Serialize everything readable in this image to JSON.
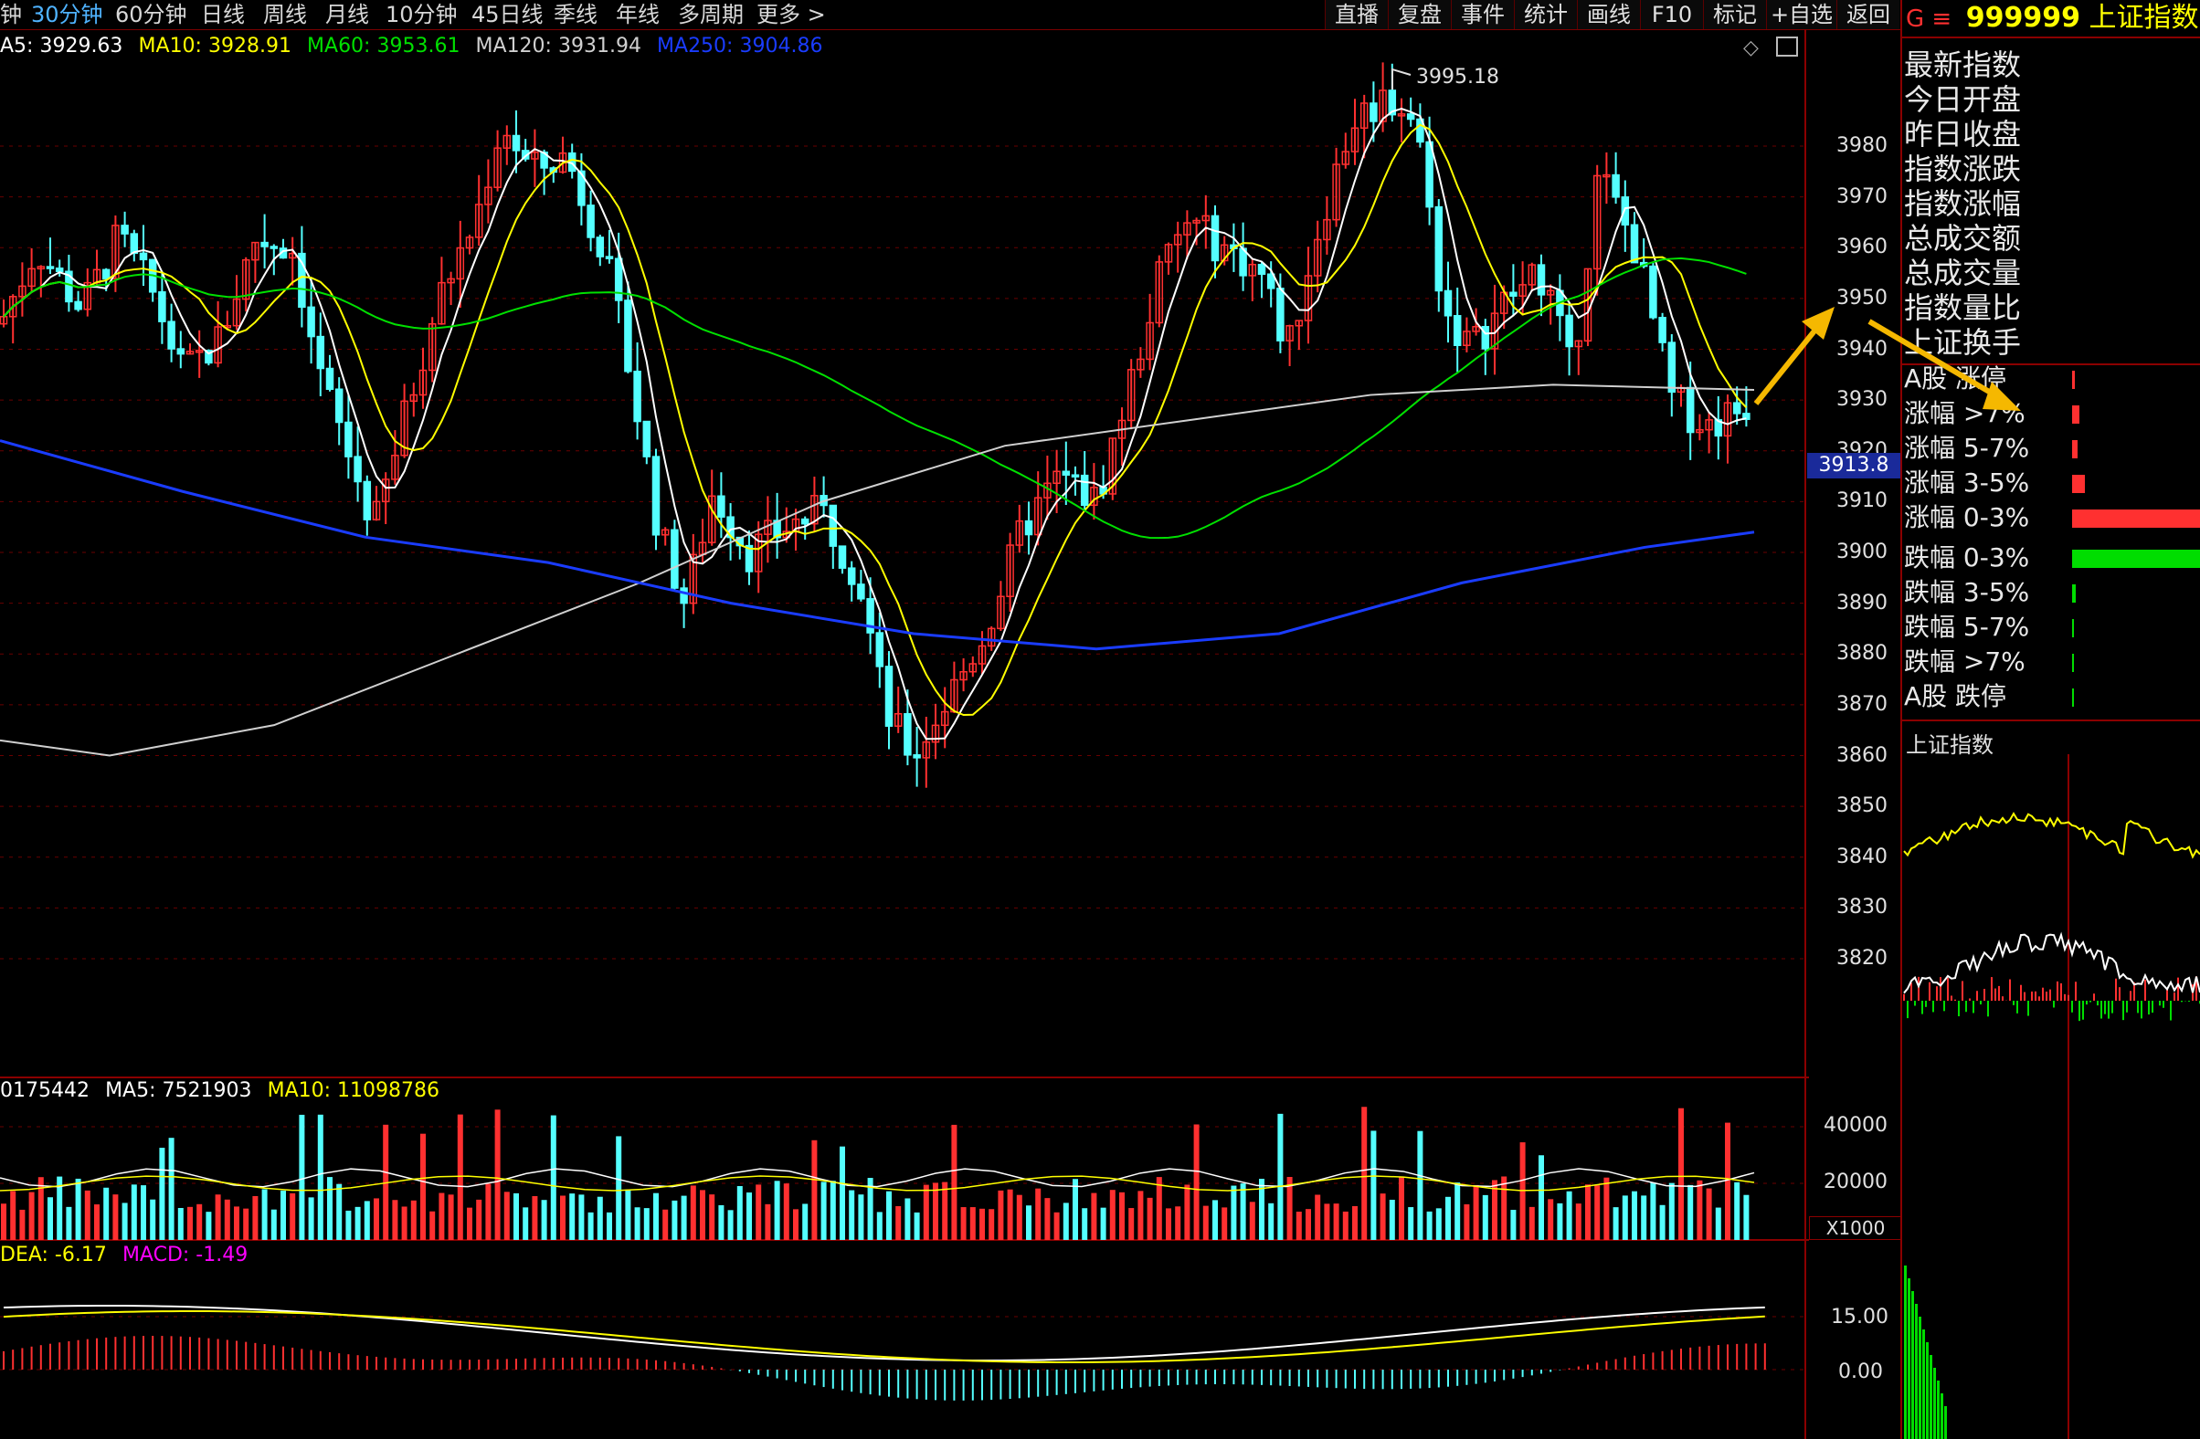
{
  "toolbar": {
    "timeframes": [
      "钟",
      "30分钟",
      "60分钟",
      "日线",
      "周线",
      "月线",
      "10分钟",
      "45日线",
      "季线",
      "年线",
      "多周期",
      "更多 >"
    ],
    "active_timeframe": "30分钟",
    "tools": [
      "直播",
      "复盘",
      "事件",
      "统计",
      "画线",
      "F10",
      "标记",
      "+自选",
      "返回"
    ]
  },
  "ma_legend": [
    {
      "label": "A5: 3929.63",
      "color": "#ffffff"
    },
    {
      "label": "MA10: 3928.91",
      "color": "#ffff00"
    },
    {
      "label": "MA60: 3953.61",
      "color": "#00e000"
    },
    {
      "label": "MA120: 3931.94",
      "color": "#d0d0d0"
    },
    {
      "label": "MA250: 3904.86",
      "color": "#1a3cff"
    }
  ],
  "price_axis": {
    "ticks": [
      "3980",
      "3970",
      "3960",
      "3950",
      "3940",
      "3930",
      "3920",
      "3910",
      "3900",
      "3890",
      "3880",
      "3870",
      "3860",
      "3850",
      "3840",
      "3830",
      "3820"
    ],
    "current_price_label": "3913.8",
    "high_annotation": "3995.18"
  },
  "volume": {
    "legend": [
      {
        "label": "0175442",
        "color": "#ffffff"
      },
      {
        "label": "MA5: 7521903",
        "color": "#ffffff"
      },
      {
        "label": "MA10: 11098786",
        "color": "#ffff00"
      }
    ],
    "ticks": [
      "40000",
      "20000"
    ],
    "unit": "X1000"
  },
  "macd": {
    "legend": [
      {
        "label": "DEA: -6.17",
        "color": "#ffff00"
      },
      {
        "label": "MACD: -1.49",
        "color": "#ff00ff"
      }
    ],
    "ticks": [
      "15.00",
      "0.00"
    ]
  },
  "right_panel": {
    "title_prefix": "G ≡",
    "title_code": "999999",
    "title_name": "上证指数",
    "quote_labels": [
      "最新指数",
      "今日开盘",
      "昨日收盘",
      "指数涨跌",
      "指数涨幅",
      "总成交额",
      "总成交量",
      "指数量比",
      "上证换手"
    ],
    "distribution": [
      {
        "label": "A股 涨停",
        "share": 0.02,
        "color": "#ff3030"
      },
      {
        "label": "涨幅 >7%",
        "share": 0.06,
        "color": "#ff3030"
      },
      {
        "label": "涨幅 5-7%",
        "share": 0.04,
        "color": "#ff3030"
      },
      {
        "label": "涨幅 3-5%",
        "share": 0.1,
        "color": "#ff3030"
      },
      {
        "label": "涨幅 0-3%",
        "share": 1.0,
        "color": "#ff3030"
      },
      {
        "label": "跌幅 0-3%",
        "share": 1.0,
        "color": "#00dd00"
      },
      {
        "label": "跌幅 3-5%",
        "share": 0.03,
        "color": "#00dd00"
      },
      {
        "label": "跌幅 5-7%",
        "share": 0.01,
        "color": "#00dd00"
      },
      {
        "label": "跌幅 >7%",
        "share": 0.01,
        "color": "#00dd00"
      },
      {
        "label": "A股 跌停",
        "share": 0.01,
        "color": "#00dd00"
      }
    ],
    "mini_chart_title": "上证指数"
  },
  "colors": {
    "up": "#ff3030",
    "down": "#54ffff",
    "grid": "#6a0000",
    "annotation_arrow": "#f5b800"
  }
}
